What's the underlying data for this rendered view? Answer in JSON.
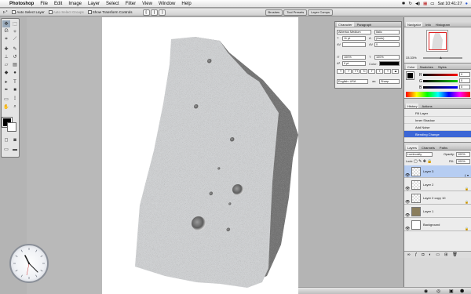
{
  "menubar": {
    "apple": "",
    "app": "Photoshop",
    "items": [
      "File",
      "Edit",
      "Image",
      "Layer",
      "Select",
      "Filter",
      "View",
      "Window",
      "Help"
    ],
    "status": {
      "time": "Sat 10:41:27"
    }
  },
  "options": {
    "auto_select_layer": "Auto Select Layer",
    "auto_select_groups": "Auto Select Groups",
    "show_transform": "Show Transform Controls",
    "tabs": [
      "Brushes",
      "Tool Presets",
      "Layer Comps"
    ]
  },
  "character": {
    "tabs": [
      "Character",
      "Paragraph"
    ],
    "font_family": "Albertus Medium",
    "font_style": "Italic",
    "size": "11 pt",
    "leading": "(Auto)",
    "kerning": "",
    "tracking": "0",
    "vscale": "100%",
    "hscale": "100%",
    "baseline": "0 pt",
    "color_label": "Color:",
    "language": "English: USA",
    "aa": "Sharp",
    "styles": [
      "T",
      "T",
      "TT",
      "Tr",
      "T'",
      "T,",
      "T",
      "T"
    ]
  },
  "navigator": {
    "tabs": [
      "Navigator",
      "Info",
      "Histogram"
    ],
    "zoom": "33.33%"
  },
  "color": {
    "tabs": [
      "Color",
      "Swatches",
      "Styles"
    ],
    "rows": [
      {
        "label": "R",
        "value": "0"
      },
      {
        "label": "G",
        "value": "0"
      },
      {
        "label": "B",
        "value": "0"
      }
    ]
  },
  "history": {
    "tabs": [
      "History",
      "Actions"
    ],
    "items": [
      "Fill Layer",
      "Inner Shadow",
      "Add Noise",
      "Blending Change"
    ],
    "selected_index": 3
  },
  "layers": {
    "tabs": [
      "Layers",
      "Channels",
      "Paths"
    ],
    "blend": "Luminosity",
    "opacity_label": "Opacity:",
    "opacity": "100%",
    "lock_label": "Lock:",
    "fill_label": "Fill:",
    "fill": "100%",
    "items": [
      "Layer 3",
      "Layer 2",
      "Layer 2 copy 10",
      "Layer 1",
      "Background"
    ],
    "selected_index": 0
  }
}
